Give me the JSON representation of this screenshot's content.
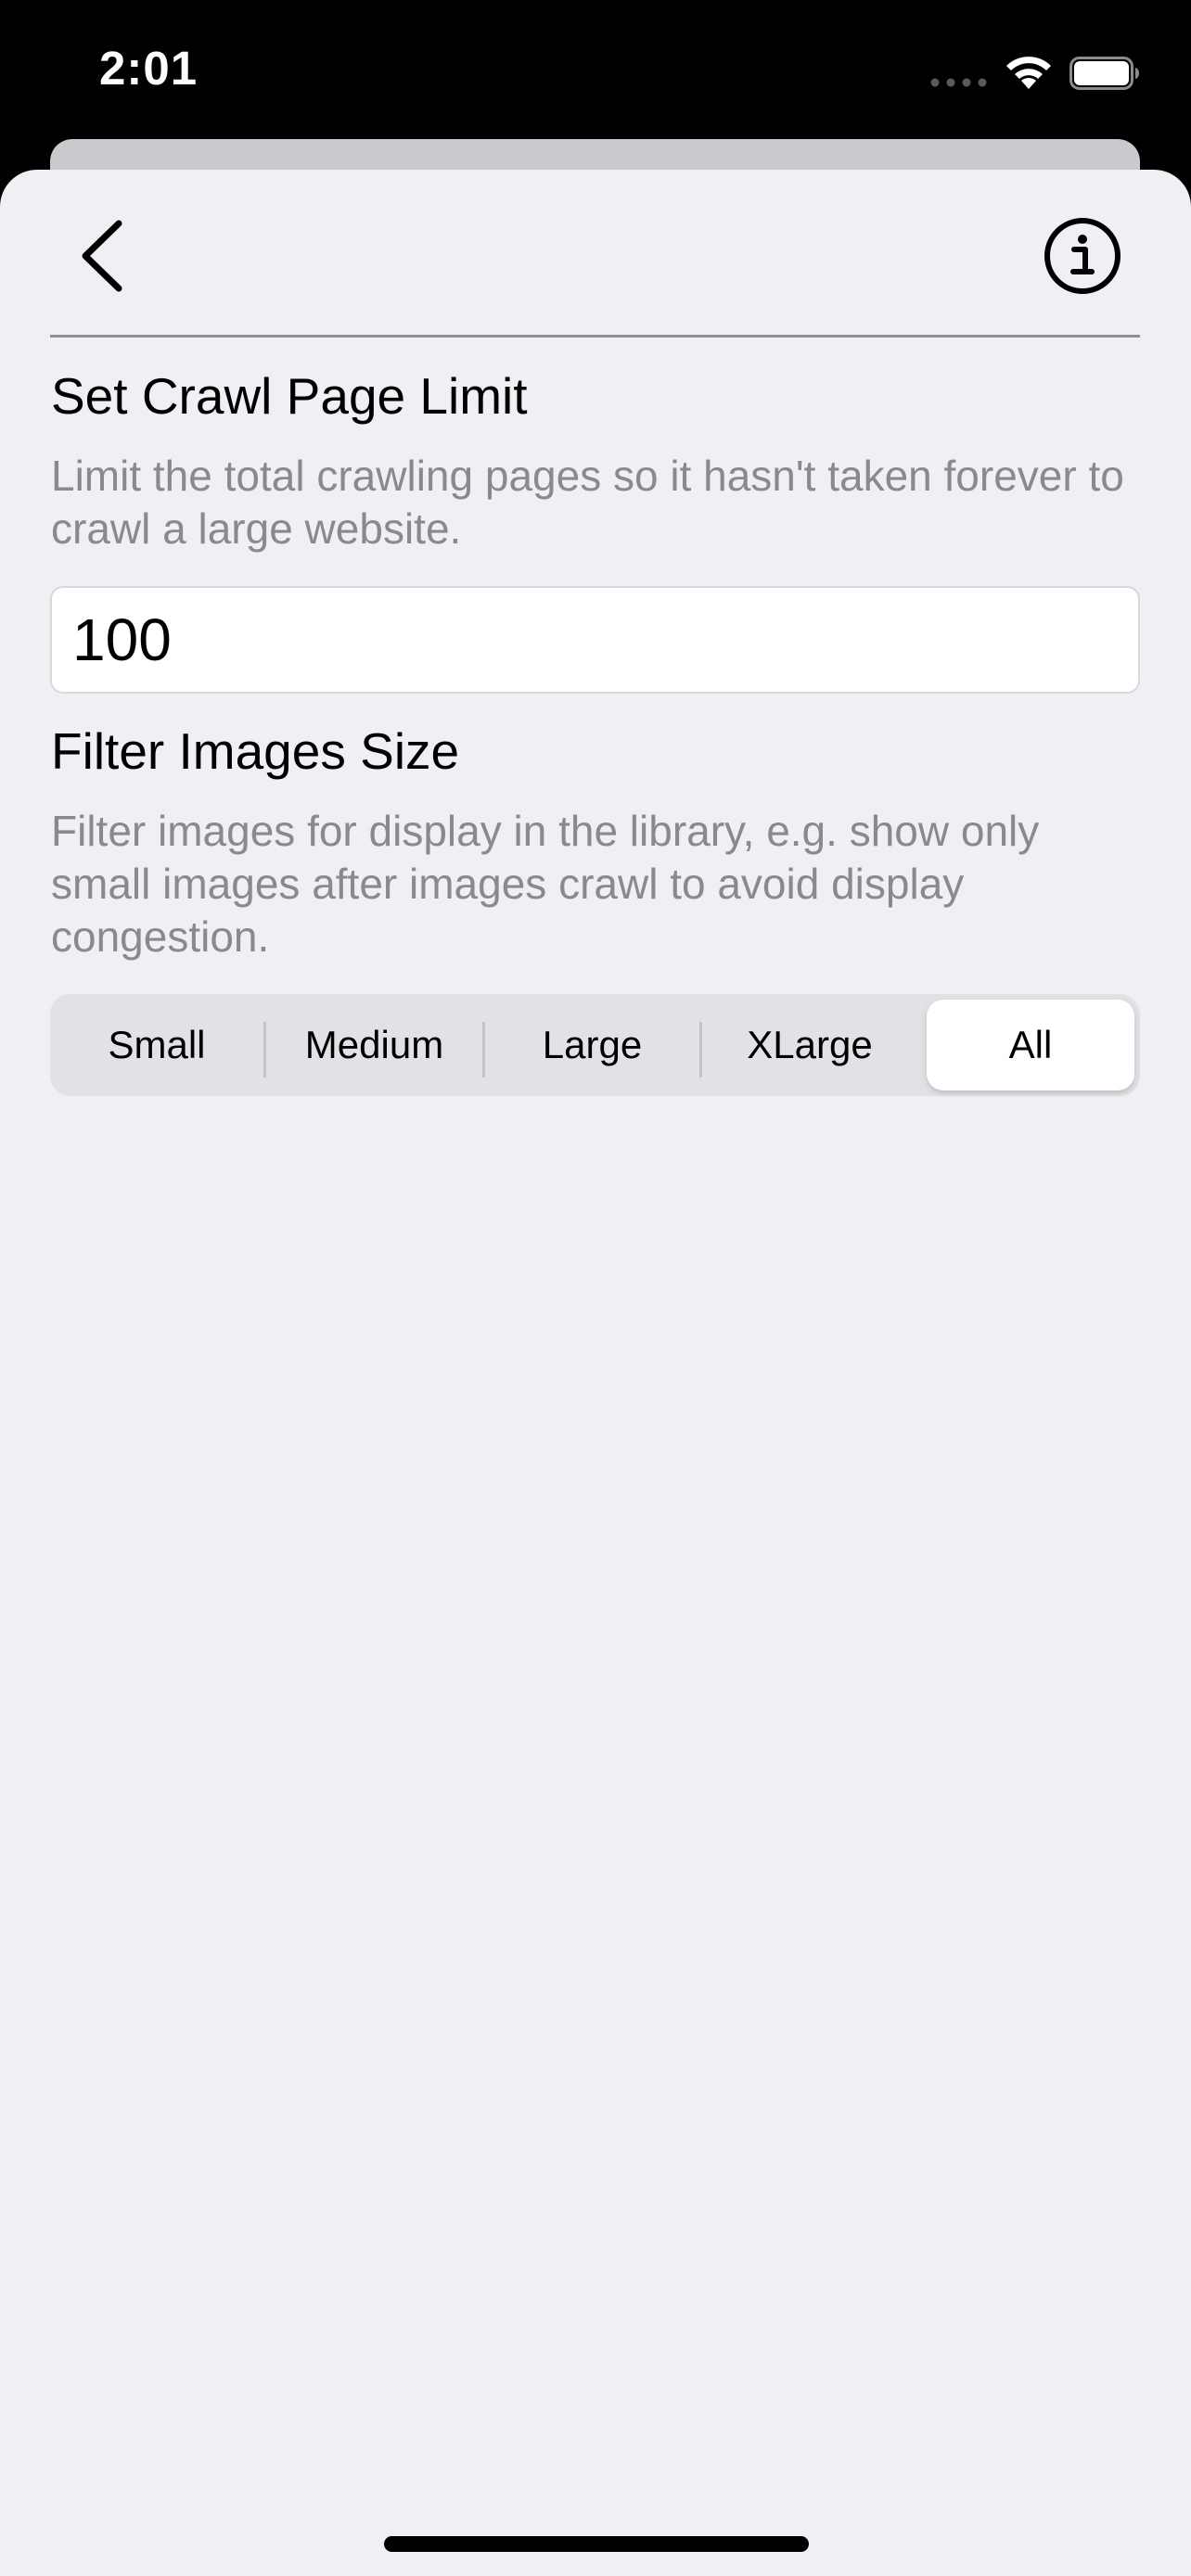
{
  "status_bar": {
    "time": "2:01",
    "icons": [
      "signal-dots-icon",
      "wifi-icon",
      "battery-icon"
    ]
  },
  "nav": {
    "back_icon": "chevron-left-icon",
    "info_icon": "info-circle-icon"
  },
  "crawl_limit": {
    "title": "Set Crawl Page Limit",
    "description": "Limit the total crawling pages so it hasn't taken forever to crawl a large website.",
    "value": "100"
  },
  "filter_images": {
    "title": "Filter Images Size",
    "description": "Filter images for display in the library, e.g. show only small images after images crawl to avoid display congestion.",
    "segments": [
      {
        "label": "Small"
      },
      {
        "label": "Medium"
      },
      {
        "label": "Large"
      },
      {
        "label": "XLarge"
      },
      {
        "label": "All"
      }
    ],
    "selected": "All"
  },
  "colors": {
    "sheet_background": "#efeff4",
    "secondary_text": "#8a8a8e",
    "segment_background": "#e1e1e6",
    "selected_segment": "#ffffff"
  }
}
